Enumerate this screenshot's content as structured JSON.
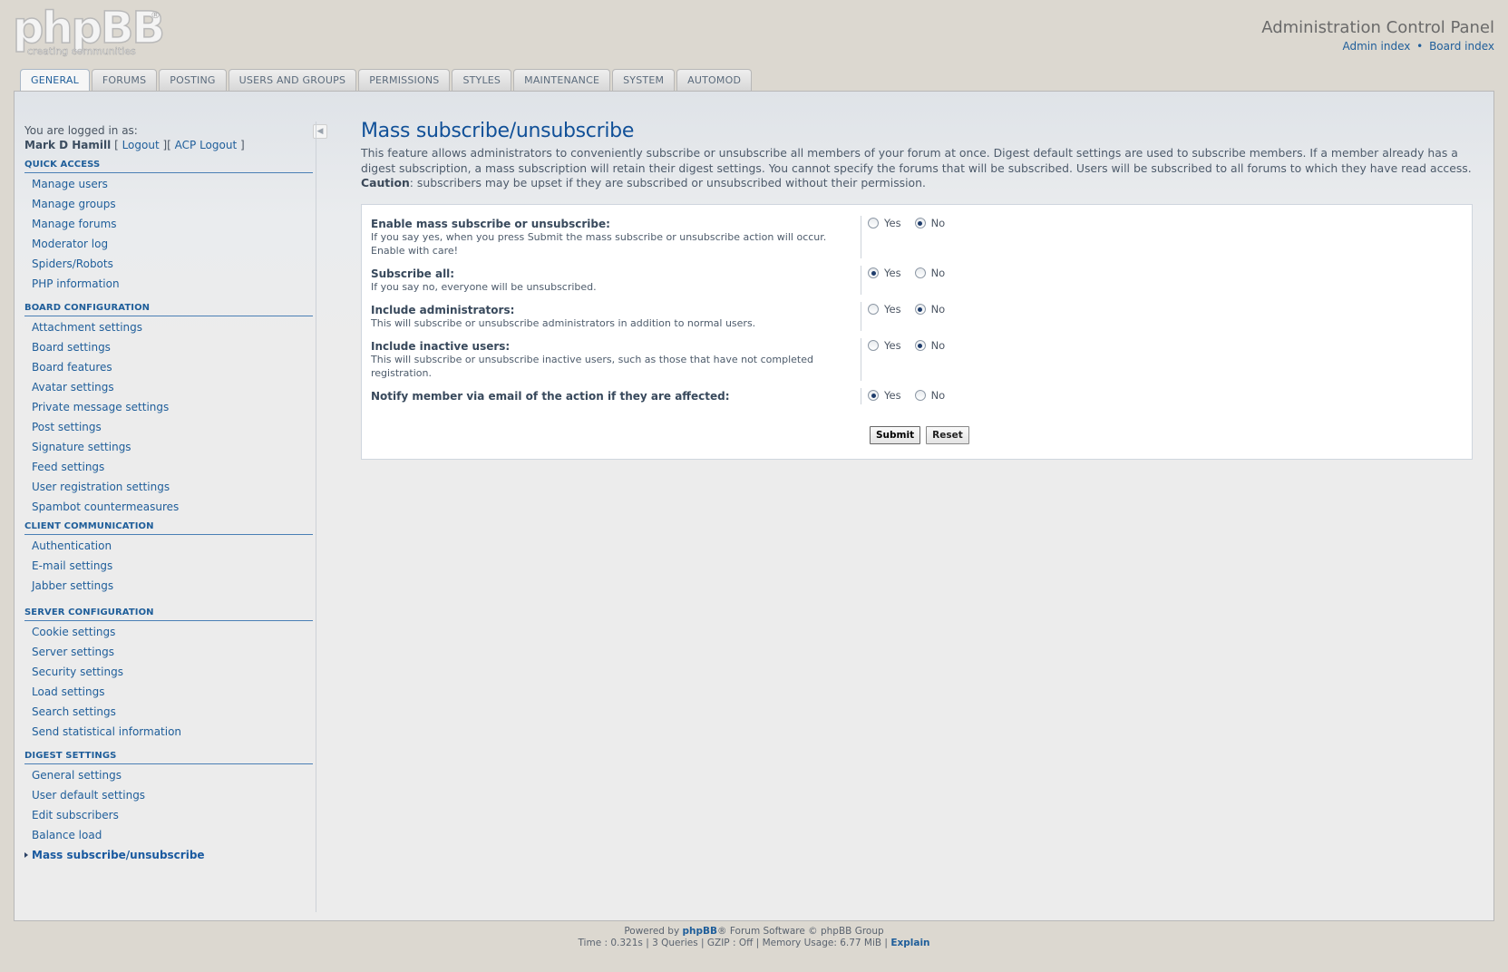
{
  "header": {
    "logo_text": "phpBB",
    "logo_reg": "®",
    "logo_tagline": "creating communities",
    "panel_title": "Administration Control Panel",
    "links": [
      "Admin index",
      "Board index"
    ],
    "link_separator": "•"
  },
  "tabs": [
    {
      "label": "GENERAL",
      "active": true
    },
    {
      "label": "FORUMS",
      "active": false
    },
    {
      "label": "POSTING",
      "active": false
    },
    {
      "label": "USERS AND GROUPS",
      "active": false
    },
    {
      "label": "PERMISSIONS",
      "active": false
    },
    {
      "label": "STYLES",
      "active": false
    },
    {
      "label": "MAINTENANCE",
      "active": false
    },
    {
      "label": "SYSTEM",
      "active": false
    },
    {
      "label": "AUTOMOD",
      "active": false
    }
  ],
  "login": {
    "prefix": "You are logged in as:",
    "username": "Mark D Hamill",
    "logout": "Logout",
    "acp_logout": "ACP Logout",
    "collapse_icon": "◀"
  },
  "sidebar": [
    {
      "heading": "QUICK ACCESS",
      "items": [
        "Manage users",
        "Manage groups",
        "Manage forums",
        "Moderator log",
        "Spiders/Robots",
        "PHP information"
      ]
    },
    {
      "heading": "BOARD CONFIGURATION",
      "items": [
        "Attachment settings",
        "Board settings",
        "Board features",
        "Avatar settings",
        "Private message settings",
        "Post settings",
        "Signature settings",
        "Feed settings",
        "User registration settings",
        "Spambot countermeasures"
      ]
    },
    {
      "heading": "CLIENT COMMUNICATION",
      "items": [
        "Authentication",
        "E-mail settings",
        "Jabber settings"
      ]
    },
    {
      "heading": "SERVER CONFIGURATION",
      "items": [
        "Cookie settings",
        "Server settings",
        "Security settings",
        "Load settings",
        "Search settings",
        "Send statistical information"
      ]
    },
    {
      "heading": "DIGEST SETTINGS",
      "items": [
        "General settings",
        "User default settings",
        "Edit subscribers",
        "Balance load",
        "Mass subscribe/unsubscribe"
      ],
      "current": 4
    }
  ],
  "content": {
    "title": "Mass subscribe/unsubscribe",
    "description_main": "This feature allows administrators to conveniently subscribe or unsubscribe all members of your forum at once. Digest default settings are used to subscribe members. If a member already has a digest subscription, a mass subscription will retain their digest settings. You cannot specify the forums that will be subscribed. Users will be subscribed to all forums to which they have read access. ",
    "description_caution_label": "Caution",
    "description_caution_text": ": subscribers may be upset if they are subscribed or unsubscribed without their permission.",
    "settings": [
      {
        "title": "Enable mass subscribe or unsubscribe:",
        "hint": "If you say yes, when you press Submit the mass subscribe or unsubscribe action will occur. Enable with care!",
        "yes_label": "Yes",
        "no_label": "No",
        "value": "No"
      },
      {
        "title": "Subscribe all:",
        "hint": "If you say no, everyone will be unsubscribed.",
        "yes_label": "Yes",
        "no_label": "No",
        "value": "Yes"
      },
      {
        "title": "Include administrators:",
        "hint": "This will subscribe or unsubscribe administrators in addition to normal users.",
        "yes_label": "Yes",
        "no_label": "No",
        "value": "No"
      },
      {
        "title": "Include inactive users:",
        "hint": "This will subscribe or unsubscribe inactive users, such as those that have not completed registration.",
        "yes_label": "Yes",
        "no_label": "No",
        "value": "No"
      },
      {
        "title": "Notify member via email of the action if they are affected:",
        "hint": "",
        "yes_label": "Yes",
        "no_label": "No",
        "value": "Yes"
      }
    ],
    "submit_label": "Submit",
    "reset_label": "Reset"
  },
  "footer": {
    "line1_prefix": "Powered by ",
    "line1_brand": "phpBB",
    "line1_suffix": "® Forum Software © phpBB Group",
    "line2": "Time : 0.321s | 3 Queries | GZIP : Off | Memory Usage: 6.77 MiB | ",
    "explain": "Explain"
  }
}
